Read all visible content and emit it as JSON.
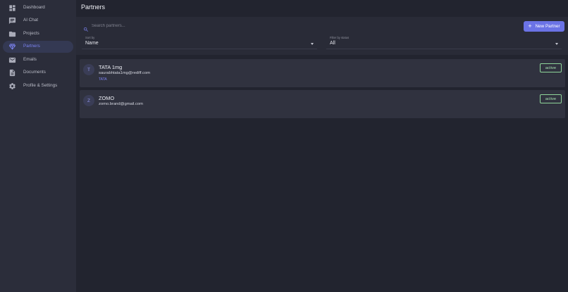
{
  "sidebar": {
    "items": [
      {
        "label": "Dashboard",
        "icon": "dashboard-icon",
        "active": false
      },
      {
        "label": "AI Chat",
        "icon": "chat-icon",
        "active": false
      },
      {
        "label": "Projects",
        "icon": "folder-icon",
        "active": false
      },
      {
        "label": "Partners",
        "icon": "diamond-icon",
        "active": true
      },
      {
        "label": "Emails",
        "icon": "mail-icon",
        "active": false
      },
      {
        "label": "Documents",
        "icon": "document-icon",
        "active": false
      },
      {
        "label": "Profile & Settings",
        "icon": "gear-icon",
        "active": false
      }
    ]
  },
  "header": {
    "title": "Partners"
  },
  "search": {
    "placeholder": "Search partners..."
  },
  "toolbar": {
    "new_partner_label": "New Partner",
    "sort": {
      "label": "Sort by",
      "value": "Name"
    },
    "filter": {
      "label": "Filter by status",
      "value": "All"
    }
  },
  "partners": [
    {
      "initial": "T",
      "name": "TATA 1mg",
      "email": "saurabhtata1mg@rediff.com",
      "tag": "TATA",
      "status": "active"
    },
    {
      "initial": "Z",
      "name": "ZOMO",
      "email": "zomo.brand@gmail.com",
      "tag": "",
      "status": "active"
    }
  ],
  "colors": {
    "accent": "#6b73e6",
    "sidebar_bg": "#2b2d3a",
    "page_bg": "#22242f",
    "card_bg": "#30323f",
    "status_active": "#8fd69a"
  }
}
